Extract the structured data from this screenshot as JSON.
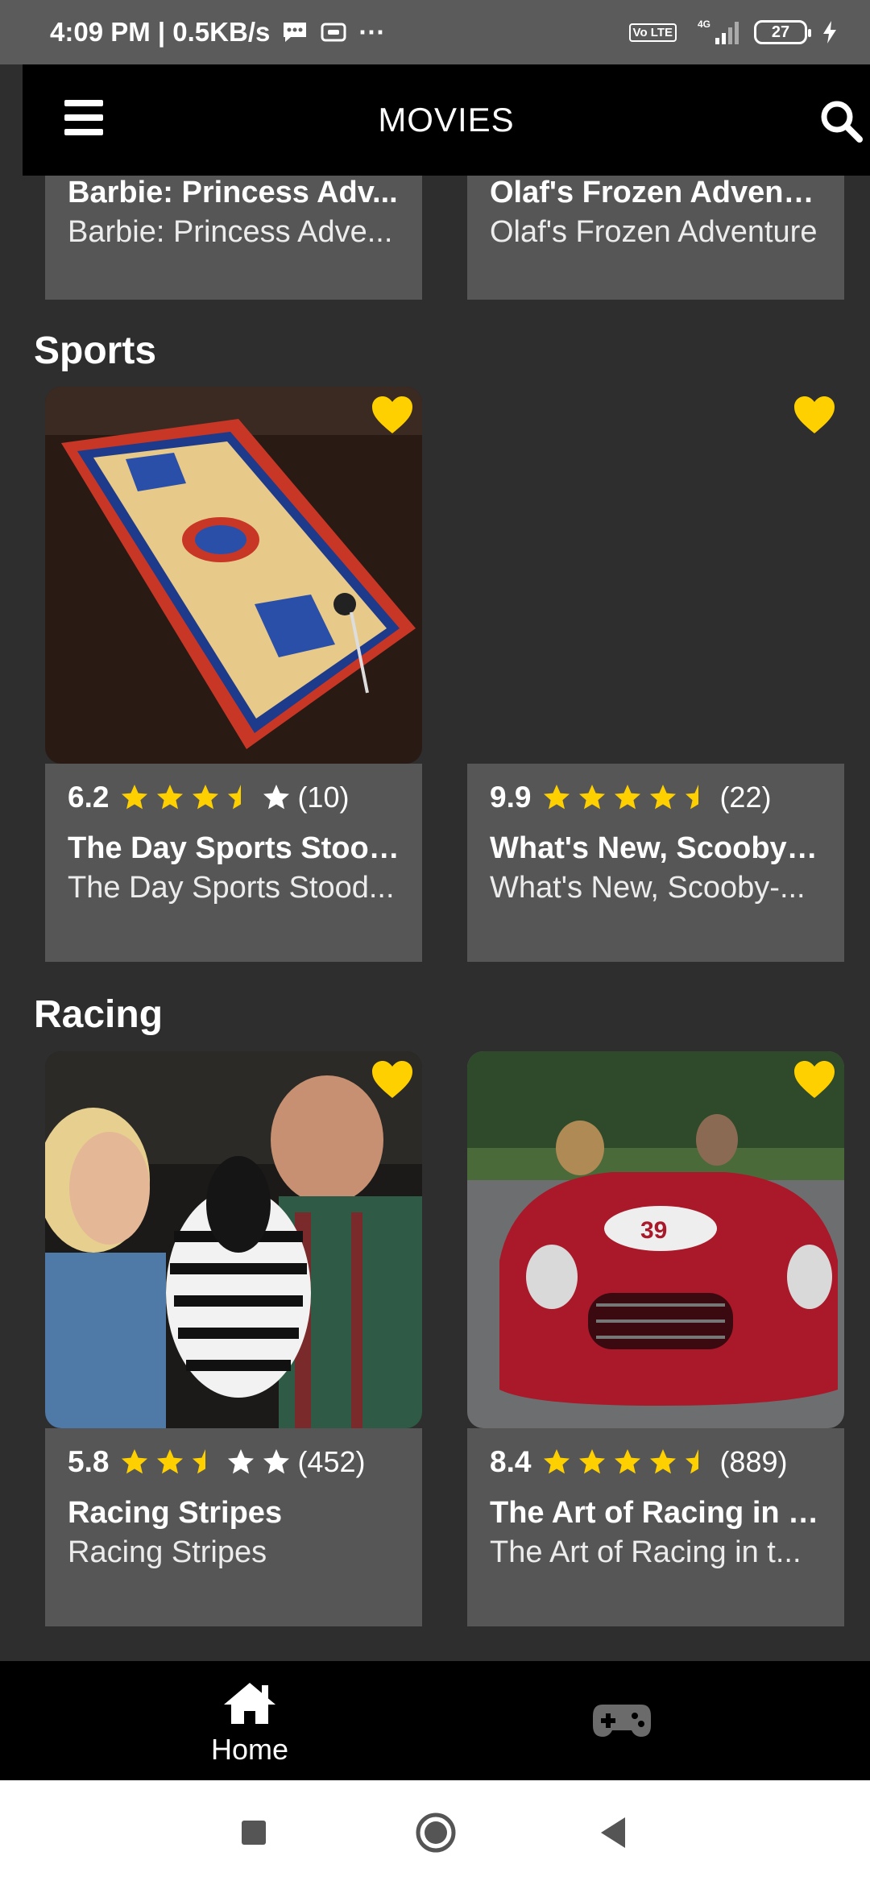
{
  "status_bar": {
    "time_speed": "4:09 PM | 0.5KB/s",
    "more": "···",
    "volte": "Vo LTE",
    "network": "4G",
    "battery": "27"
  },
  "app_bar": {
    "title": "MOVIES"
  },
  "top_row": [
    {
      "title": "Barbie: Princess Adv...",
      "subtitle": "Barbie: Princess Adve..."
    },
    {
      "title": "Olaf's Frozen Adventu...",
      "subtitle": "Olaf's Frozen Adventure"
    }
  ],
  "sections": [
    {
      "title": "Sports",
      "cards": [
        {
          "score": "6.2",
          "rating_stars": 3.5,
          "count": "(10)",
          "title": "The Day Sports Stood...",
          "subtitle": "The Day Sports Stood..."
        },
        {
          "score": "9.9",
          "rating_stars": 4.5,
          "count": "(22)",
          "title": "What's New, Scooby-...",
          "subtitle": "What's New, Scooby-..."
        }
      ]
    },
    {
      "title": "Racing",
      "cards": [
        {
          "score": "5.8",
          "rating_stars": 2.5,
          "count": "(452)",
          "title": "Racing Stripes",
          "subtitle": "Racing Stripes"
        },
        {
          "score": "8.4",
          "rating_stars": 4.5,
          "count": "(889)",
          "title": "The Art of Racing in t...",
          "subtitle": "The Art of Racing in t..."
        }
      ]
    }
  ],
  "bottom_nav": {
    "home_label": "Home"
  },
  "colors": {
    "accent": "#ffd000",
    "background": "#2f2e2f",
    "card_info": "#575657",
    "bar": "#000000"
  }
}
